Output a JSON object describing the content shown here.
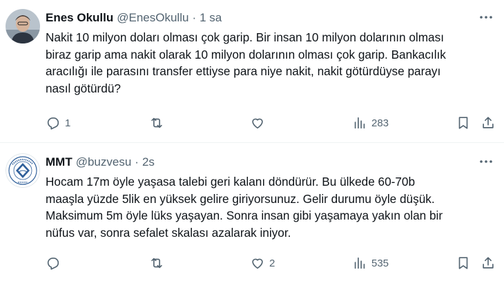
{
  "tweets": [
    {
      "author_name": "Enes Okullu",
      "handle": "@EnesOkullu",
      "separator": "·",
      "time": "1 sa",
      "text": "Nakit 10 milyon doları olması çok garip. Bir insan 10 milyon dolarının olması\nbiraz garip ama nakit olarak 10 milyon dolarının olması çok garip. Bankacılık\naracılığı ile parasını transfer ettiyse para niye nakit, nakit götürdüyse parayı\nnasıl götürdü?",
      "reply_count": "1",
      "retweet_count": "",
      "like_count": "",
      "view_count": "283",
      "icons": [
        "more-icon",
        "reply-icon",
        "retweet-icon",
        "like-icon",
        "views-icon",
        "bookmark-icon",
        "share-icon"
      ]
    },
    {
      "author_name": "MMT",
      "handle": "@buzvesu",
      "separator": "·",
      "time": "2s",
      "text": "Hocam 17m öyle yaşasa talebi geri kalanı döndürür. Bu ülkede 60-70b\nmaaşla yüzde 5lik en yüksek gelire giriyorsunuz. Gelir durumu öyle düşük.\nMaksimum 5m öyle lüks yaşayan. Sonra insan gibi yaşamaya yakın olan bir\nnüfus var, sonra sefalet skalası azalarak iniyor.",
      "reply_count": "",
      "retweet_count": "",
      "like_count": "2",
      "view_count": "535",
      "icons": [
        "more-icon",
        "reply-icon",
        "retweet-icon",
        "like-icon",
        "views-icon",
        "bookmark-icon",
        "share-icon"
      ]
    }
  ],
  "colors": {
    "text": "#0f1419",
    "secondary": "#536471",
    "divider": "#eff3f4"
  }
}
